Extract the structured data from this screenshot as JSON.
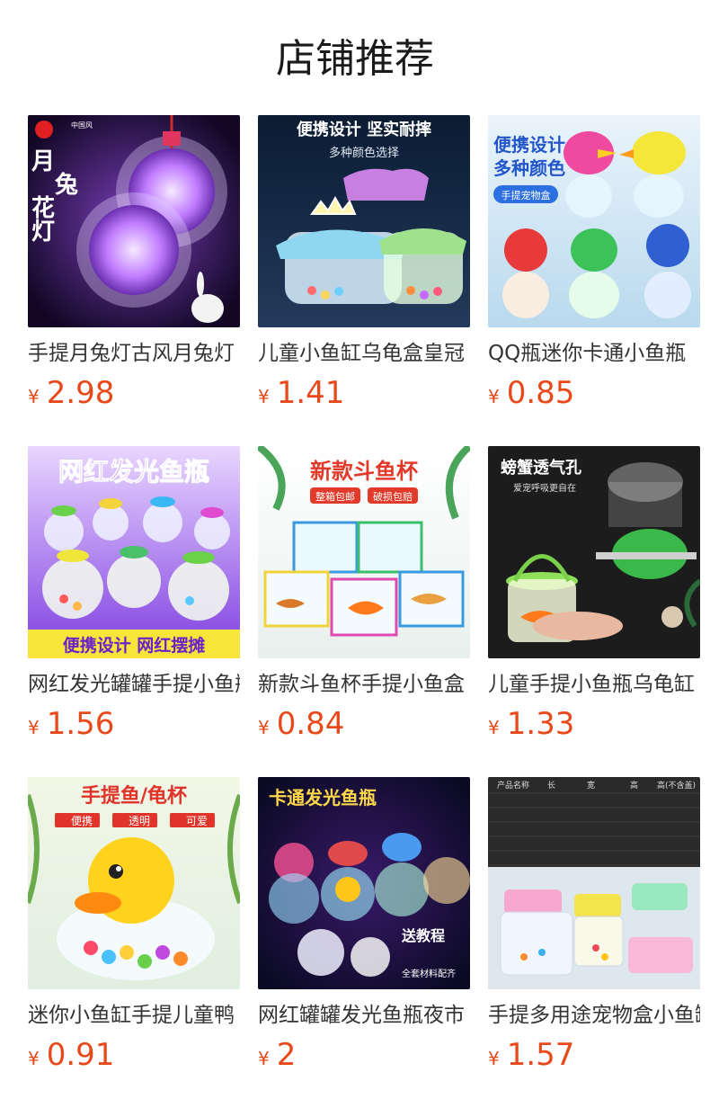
{
  "page": {
    "title": "店铺推荐"
  },
  "currency_symbol": "¥",
  "products": [
    {
      "name": "手提月兔灯古风月兔灯",
      "price": "2.98",
      "image": {
        "icon": "moon-rabbit-lantern-image",
        "lines": [
          "月",
          "兔",
          "花",
          "灯"
        ],
        "badge": "中国风"
      }
    },
    {
      "name": "儿童小鱼缸乌龟盒皇冠",
      "price": "1.41",
      "image": {
        "icon": "crown-fish-tank-image",
        "lines": [
          "便携设计 坚实耐摔",
          "多种颜色选择"
        ]
      }
    },
    {
      "name": "QQ瓶迷你卡通小鱼瓶",
      "price": "0.85",
      "image": {
        "icon": "cartoon-fish-bottle-image",
        "lines": [
          "便携设计",
          "多种颜色",
          "手提宠物盒"
        ]
      }
    },
    {
      "name": "网红发光罐罐手提小鱼瓶",
      "price": "1.56",
      "image": {
        "icon": "glowing-jar-image",
        "lines": [
          "网红发光鱼瓶",
          "便携设计 网红摆摊"
        ]
      }
    },
    {
      "name": "新款斗鱼杯手提小鱼盒",
      "price": "0.84",
      "image": {
        "icon": "betta-cup-image",
        "lines": [
          "新款斗鱼杯",
          "整箱包邮",
          "破损包赔"
        ]
      }
    },
    {
      "name": "儿童手提小鱼瓶乌龟缸",
      "price": "1.33",
      "image": {
        "icon": "crab-bucket-image",
        "lines": [
          "螃蟹透气孔",
          "爱宠呼吸更自在"
        ]
      }
    },
    {
      "name": "迷你小鱼缸手提儿童鸭",
      "price": "0.91",
      "image": {
        "icon": "duck-fish-bowl-image",
        "lines": [
          "手提鱼/龟杯",
          "便携",
          "透明",
          "可爱"
        ]
      }
    },
    {
      "name": "网红罐罐发光鱼瓶夜市",
      "price": "2",
      "image": {
        "icon": "cartoon-glow-bottle-image",
        "lines": [
          "卡通发光鱼瓶",
          "送教程",
          "全套材料配齐"
        ]
      }
    },
    {
      "name": "手提多用途宠物盒小鱼缸",
      "price": "1.57",
      "image": {
        "icon": "multi-pet-box-image",
        "lines": [
          "产品名称",
          "长",
          "宽",
          "高",
          "高(不含盖)"
        ]
      }
    }
  ]
}
